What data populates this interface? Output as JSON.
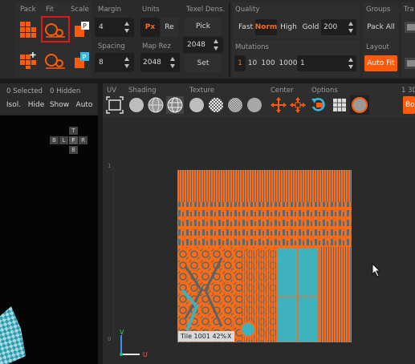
{
  "toolbar": {
    "pack_label": "Pack",
    "fit_label": "Fit",
    "scale_label": "Scale",
    "margin_label": "Margin",
    "margin_value": "4",
    "units_label": "Units",
    "units_px": "Px",
    "units_re": "Re",
    "texel_label": "Texel Dens.",
    "pick_label": "Pick",
    "spacing_label": "Spacing",
    "spacing_value": "8",
    "maprez_label": "Map Rez",
    "maprez_value1": "2048",
    "maprez_value2": "2048",
    "set_label": "Set",
    "quality_label": "Quality",
    "quality_options": [
      "Fast",
      "Norm",
      "High",
      "Gold"
    ],
    "quality_number": "200",
    "groups_label": "Groups",
    "pack_all_label": "Pack All",
    "trans_label": "Tra",
    "mutations_label": "Mutations",
    "mutation_values": [
      "1",
      "10",
      "100",
      "1000",
      "1"
    ],
    "layout_label": "Layout",
    "auto_fit_label": "Auto Fit",
    "accent_color": "#ff5a0a"
  },
  "left_panel": {
    "selected": "0 Selected",
    "hidden": "0 Hidden",
    "isol": "Isol.",
    "hide": "Hide",
    "show": "Show",
    "auto": "Auto",
    "cube_faces": [
      "T",
      "B",
      "L",
      "F",
      "R",
      "B"
    ]
  },
  "viewport_toolbar": {
    "uv_label": "UV",
    "shading_label": "Shading",
    "texture_label": "Texture",
    "center_label": "Center",
    "options_label": "Options",
    "right_label": "1 3D",
    "right_button": "Bo"
  },
  "viewport": {
    "tile_caption": "Tile 1001 42%",
    "close_glyph": "X",
    "axis_v": "V",
    "axis_u": "U",
    "ruler_top": "1",
    "ruler_bottom": "0"
  },
  "icons": [
    "pack-icon",
    "fit-icon",
    "scale-icon",
    "grid-icon",
    "wireframe-sphere-icon",
    "checker-icon",
    "move-icon",
    "rotate-icon",
    "lock-icon",
    "cursor-icon"
  ]
}
